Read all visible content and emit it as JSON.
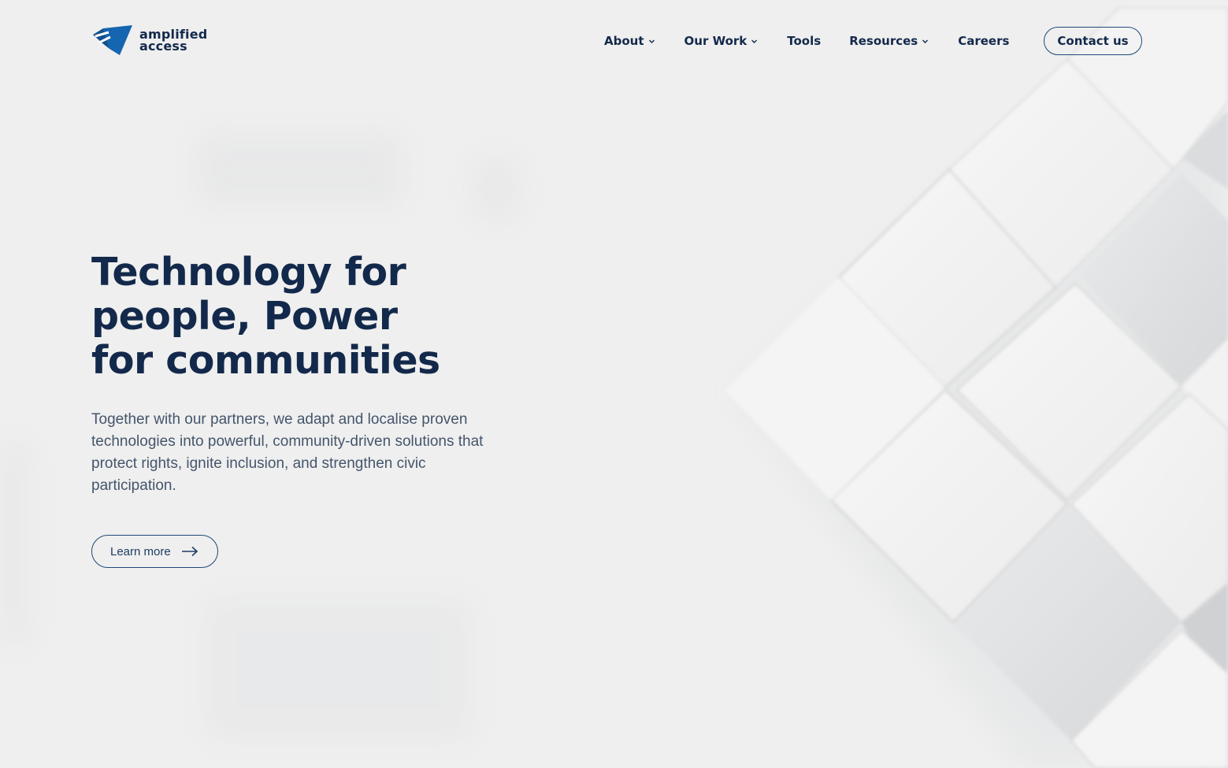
{
  "brand": {
    "name_line1": "amplified",
    "name_line2": "access",
    "logo_icon": "paper-plane-icon",
    "color_navy": "#13294b",
    "color_blue": "#1565b0"
  },
  "nav": {
    "items": [
      {
        "label": "About",
        "has_dropdown": true
      },
      {
        "label": "Our Work",
        "has_dropdown": true
      },
      {
        "label": "Tools",
        "has_dropdown": false
      },
      {
        "label": "Resources",
        "has_dropdown": true
      },
      {
        "label": "Careers",
        "has_dropdown": false
      }
    ],
    "contact_label": "Contact us"
  },
  "hero": {
    "title_lines": [
      "Technology for",
      "people, Power",
      "for communities"
    ],
    "description": "Together with our partners, we adapt and localise proven technologies into powerful, community-driven solutions that protect rights, ignite inclusion, and strengthen civic participation.",
    "cta_label": "Learn more",
    "cta_icon": "arrow-right-icon"
  }
}
